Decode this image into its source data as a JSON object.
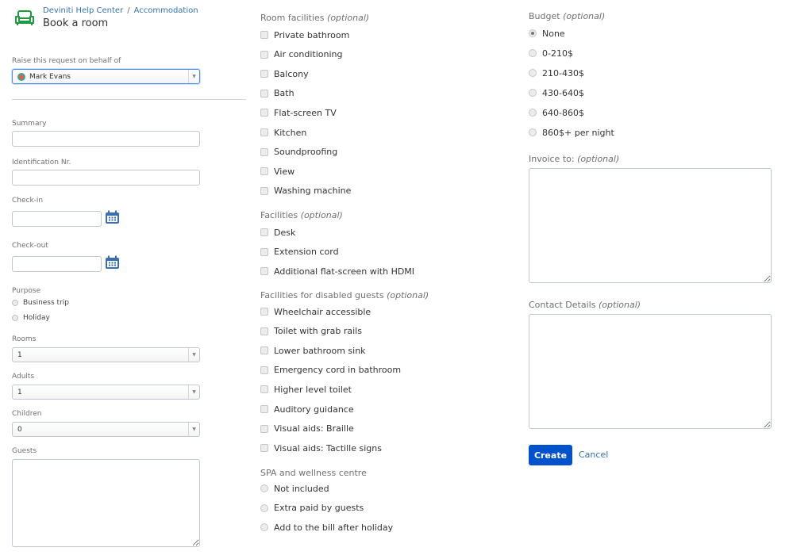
{
  "header": {
    "logo_icon": "sofa-icon",
    "breadcrumb": [
      "Deviniti Help Center",
      "Accommodation"
    ],
    "breadcrumb_separator": "/",
    "title": "Book a room"
  },
  "colors": {
    "brand_green": "#1f9a3f",
    "link_blue": "#3572b0",
    "primary_button": "#0052cc",
    "calendar_blue": "#3a6fb0"
  },
  "left": {
    "behalf": {
      "label": "Raise this request on behalf of",
      "value": "Mark Evans",
      "avatar_icon": "user-avatar-icon"
    },
    "summary": {
      "label": "Summary",
      "value": "",
      "placeholder": ""
    },
    "identification": {
      "label": "Identification Nr.",
      "value": "",
      "placeholder": ""
    },
    "checkin": {
      "label": "Check-in",
      "value": "",
      "icon": "calendar-icon"
    },
    "checkout": {
      "label": "Check-out",
      "value": "",
      "icon": "calendar-icon"
    },
    "purpose": {
      "label": "Purpose",
      "options": [
        "Business trip",
        "Holiday"
      ]
    },
    "rooms": {
      "label": "Rooms",
      "value": "1"
    },
    "adults": {
      "label": "Adults",
      "value": "1"
    },
    "children": {
      "label": "Children",
      "value": "0"
    },
    "guests": {
      "label": "Guests",
      "value": ""
    }
  },
  "middle": {
    "room_facilities": {
      "title": "Room facilities",
      "optional": "(optional)",
      "items": [
        "Private bathroom",
        "Air conditioning",
        "Balcony",
        "Bath",
        "Flat-screen TV",
        "Kitchen",
        "Soundproofing",
        "View",
        "Washing machine"
      ]
    },
    "facilities": {
      "title": "Facilities",
      "optional": "(optional)",
      "items": [
        "Desk",
        "Extension cord",
        "Additional flat-screen with HDMI"
      ]
    },
    "disabled": {
      "title": "Facilities for disabled guests",
      "optional": "(optional)",
      "items": [
        "Wheelchair accessible",
        "Toilet with grab rails",
        "Lower bathroom sink",
        "Emergency cord in bathroom",
        "Higher level toilet",
        "Auditory guidance",
        "Visual aids: Braille",
        "Visual aids: Tactille signs"
      ]
    },
    "spa": {
      "title": "SPA and wellness centre",
      "options": [
        "Not included",
        "Extra paid by guests",
        "Add to the bill after holiday"
      ]
    }
  },
  "right": {
    "budget": {
      "title": "Budget",
      "optional": "(optional)",
      "options": [
        "None",
        "0-210$",
        "210-430$",
        "430-640$",
        "640-860$",
        "860$+ per night"
      ],
      "selected": "None"
    },
    "invoice": {
      "title": "Invoice to:",
      "optional": "(optional)",
      "value": ""
    },
    "contact": {
      "title": "Contact Details",
      "optional": "(optional)",
      "value": ""
    },
    "create_label": "Create",
    "cancel_label": "Cancel"
  }
}
